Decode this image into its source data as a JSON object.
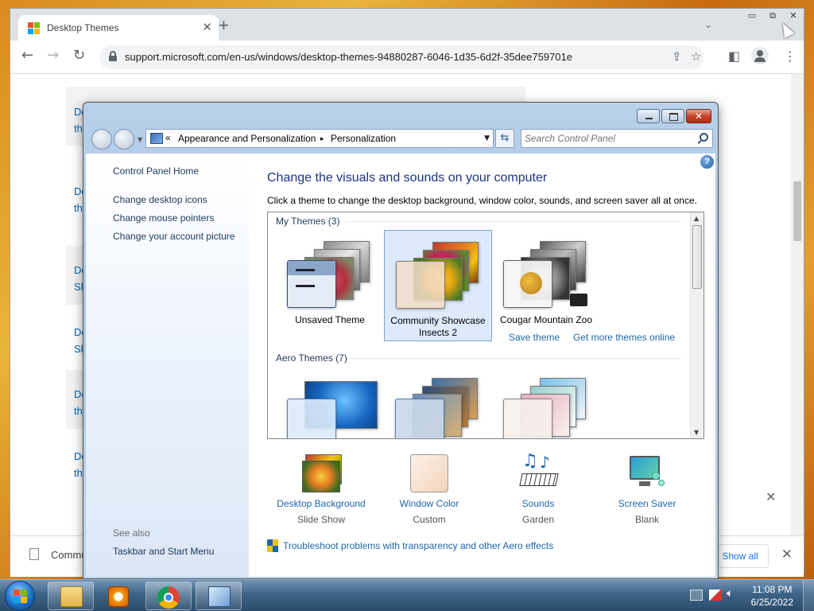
{
  "browser": {
    "tab_title": "Desktop Themes",
    "url": "support.microsoft.com/en-us/windows/desktop-themes-94880287-6046-1d35-6d2f-35dee759701e",
    "page_snippets": [
      "Do",
      "th",
      "Do",
      "th",
      "Do",
      "Sh",
      "Do",
      "Sh",
      "Do",
      "th",
      "Do",
      "th"
    ],
    "download_item": "Commu",
    "show_all_label": "Show all",
    "left_edge_letters": [
      "M",
      "D"
    ]
  },
  "control_panel": {
    "breadcrumb": {
      "prefix": "«",
      "item1": "Appearance and Personalization",
      "separator": "▸",
      "item2": "Personalization"
    },
    "search_placeholder": "Search Control Panel",
    "sidebar": {
      "home": "Control Panel Home",
      "links": [
        "Change desktop icons",
        "Change mouse pointers",
        "Change your account picture"
      ],
      "see_also": "See also",
      "see_also_links": [
        "Taskbar and Start Menu"
      ]
    },
    "title": "Change the visuals and sounds on your computer",
    "description": "Click a theme to change the desktop background, window color, sounds, and screen saver all at once.",
    "my_themes_header": "My Themes (3)",
    "my_themes": [
      {
        "label": "Unsaved Theme",
        "selected": false
      },
      {
        "label": "Community Showcase Insects 2",
        "selected": true
      },
      {
        "label": "Cougar Mountain Zoo",
        "selected": false
      }
    ],
    "save_theme": "Save theme",
    "get_more": "Get more themes online",
    "aero_header": "Aero Themes (7)",
    "settings": [
      {
        "label": "Desktop Background",
        "value": "Slide Show"
      },
      {
        "label": "Window Color",
        "value": "Custom"
      },
      {
        "label": "Sounds",
        "value": "Garden"
      },
      {
        "label": "Screen Saver",
        "value": "Blank"
      }
    ],
    "troubleshoot": "Troubleshoot problems with transparency and other Aero effects"
  },
  "taskbar": {
    "time": "11:08 PM",
    "date": "6/25/2022"
  }
}
